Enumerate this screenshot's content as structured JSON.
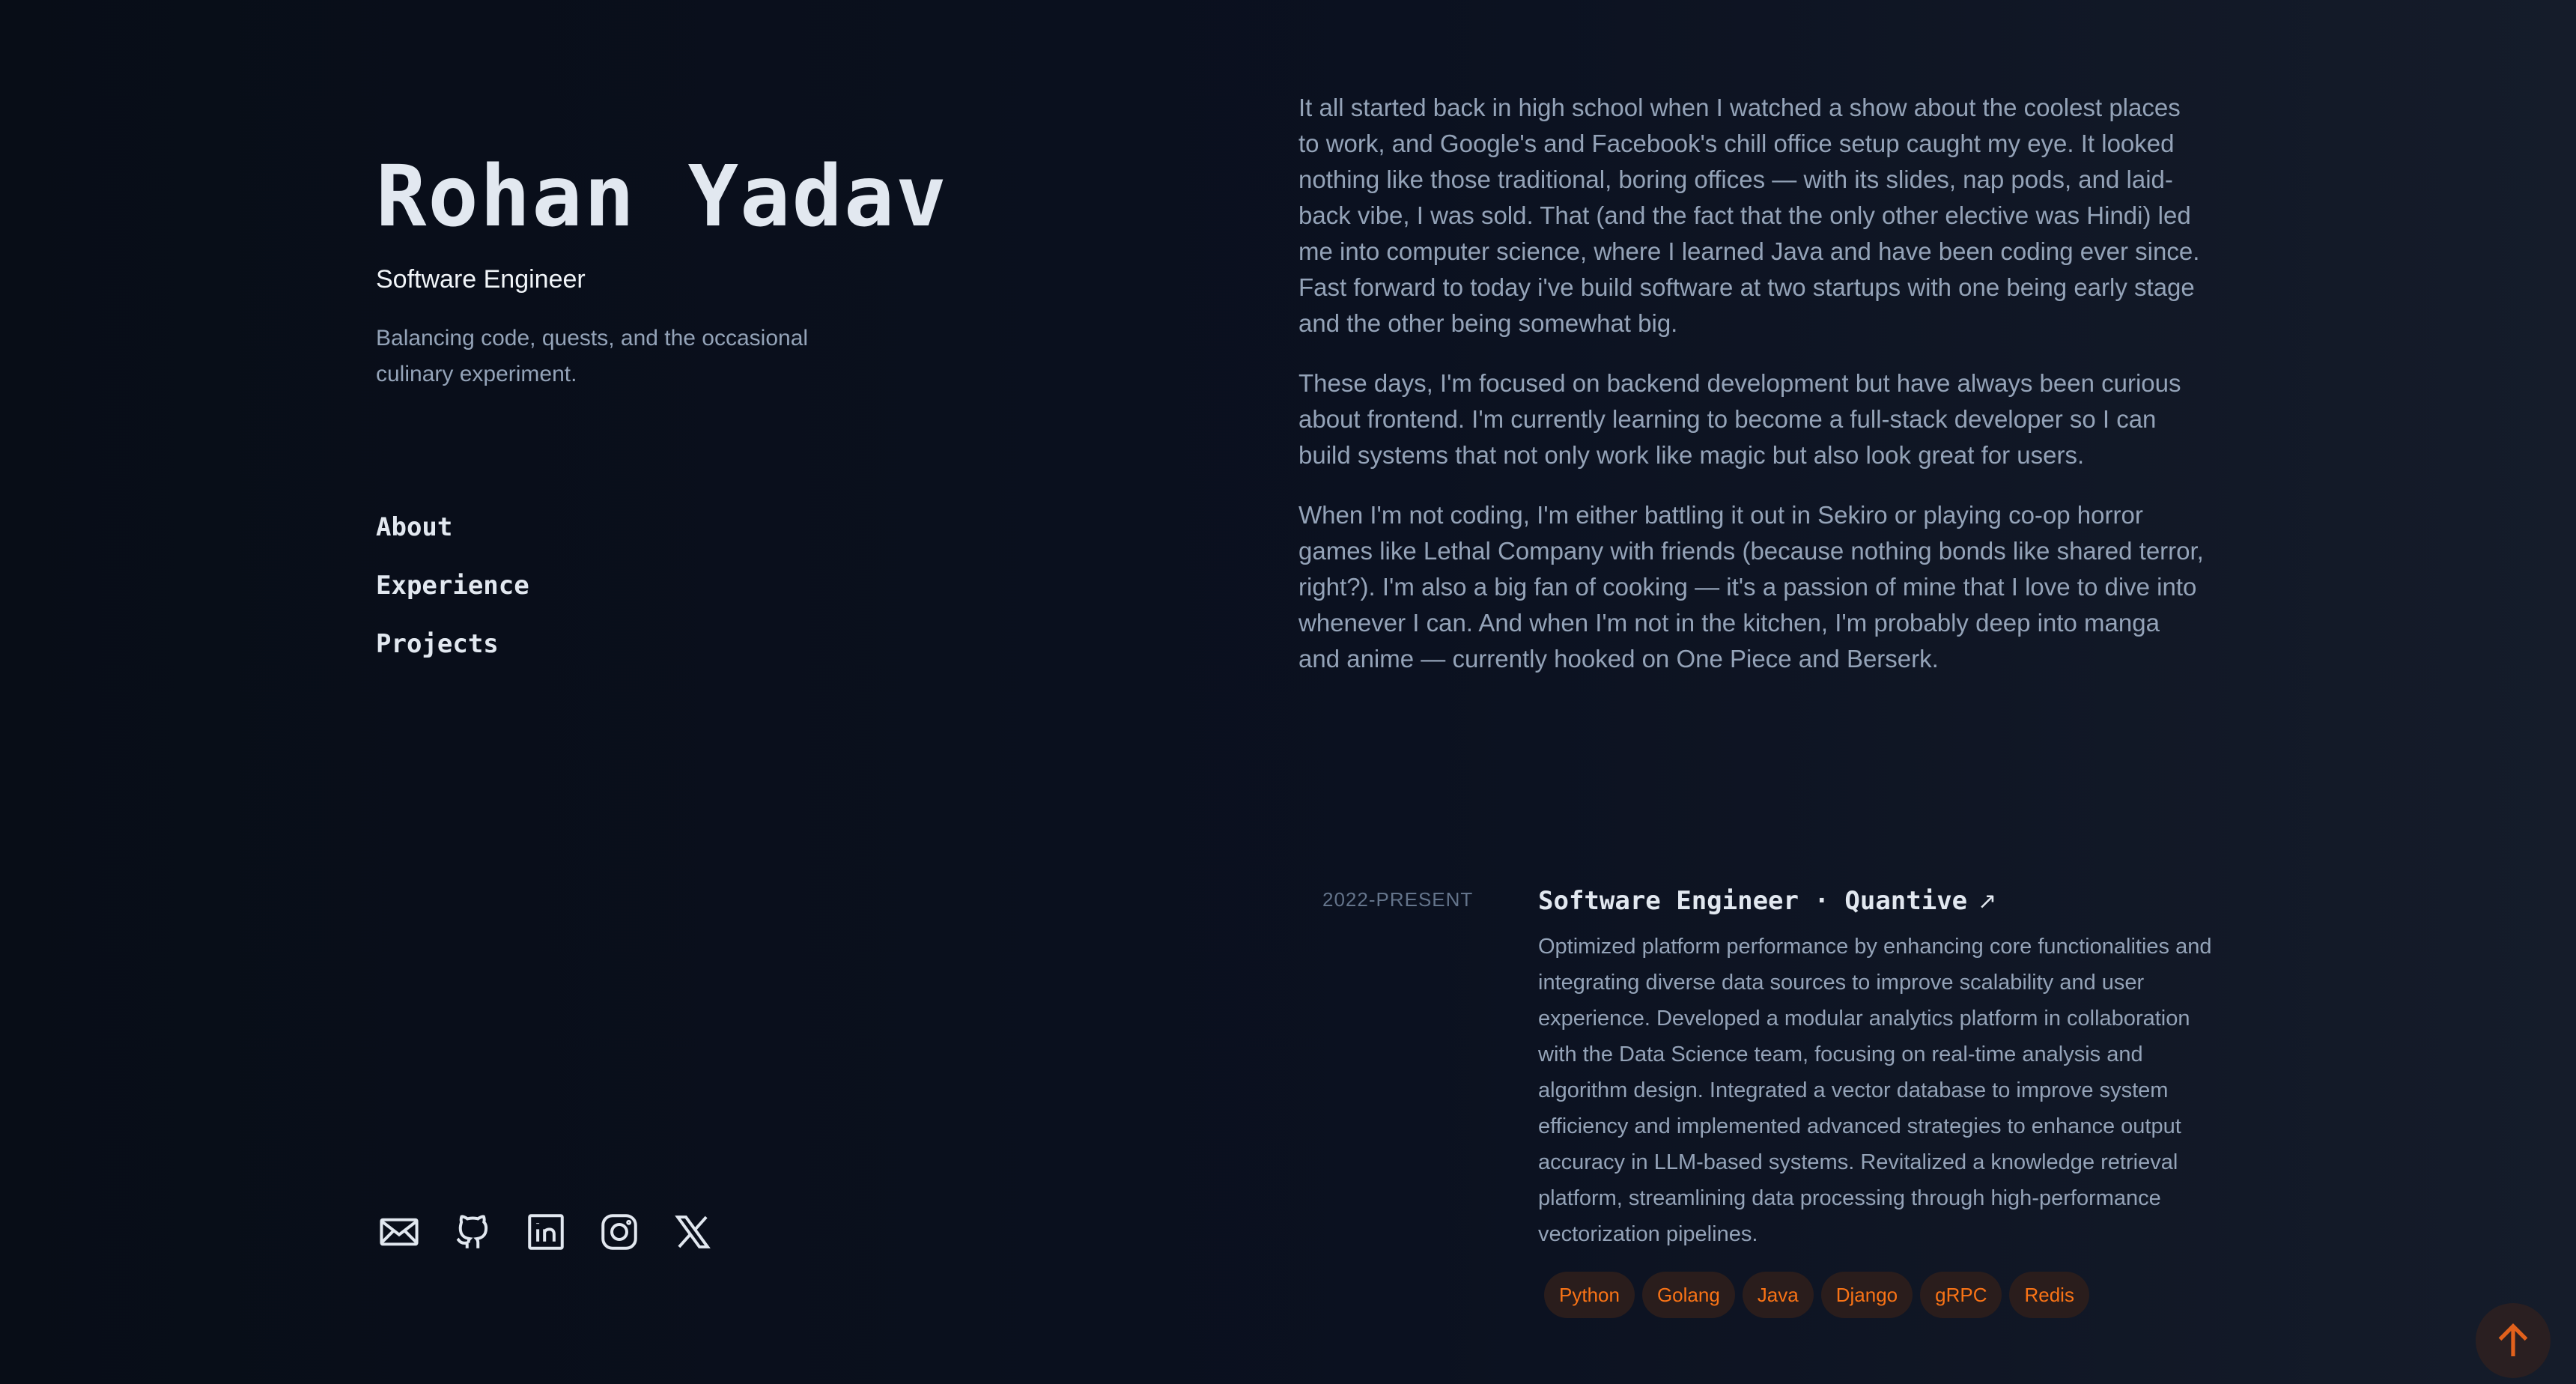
{
  "profile": {
    "name": "Rohan Yadav",
    "role": "Software Engineer",
    "tagline": "Balancing code, quests, and the occasional culinary experiment."
  },
  "nav": {
    "items": [
      "About",
      "Experience",
      "Projects"
    ]
  },
  "socials": {
    "icons": [
      "mail-icon",
      "github-icon",
      "linkedin-icon",
      "instagram-icon",
      "x-icon"
    ]
  },
  "about": {
    "paragraphs": [
      "It all started back in high school when I watched a show about the coolest places to work, and Google's and Facebook's chill office setup caught my eye. It looked nothing like those traditional, boring offices — with its slides, nap pods, and laid-back vibe, I was sold. That (and the fact that the only other elective was Hindi) led me into computer science, where I learned Java and have been coding ever since. Fast forward to today i've build software at two startups with one being early stage and the other being somewhat big.",
      "These days, I'm focused on backend development but have always been curious about frontend. I'm currently learning to become a full-stack developer so I can build systems that not only work like magic but also look great for users.",
      "When I'm not coding, I'm either battling it out in Sekiro or playing co-op horror games like Lethal Company with friends (because nothing bonds like shared terror, right?). I'm also a big fan of cooking — it's a passion of mine that I love to dive into whenever I can. And when I'm not in the kitchen, I'm probably deep into manga and anime — currently hooked on One Piece and Berserk."
    ]
  },
  "experience": {
    "date": "2022-PRESENT",
    "title": "Software Engineer · Quantive",
    "arrow": "↗",
    "description": "Optimized platform performance by enhancing core functionalities and integrating diverse data sources to improve scalability and user experience. Developed a modular analytics platform in collaboration with the Data Science team, focusing on real-time analysis and algorithm design. Integrated a vector database to improve system efficiency and implemented advanced strategies to enhance output accuracy in LLM-based systems. Revitalized a knowledge retrieval platform, streamlining data processing through high-performance vectorization pipelines.",
    "tags": [
      "Python",
      "Golang",
      "Java",
      "Django",
      "gRPC",
      "Redis"
    ]
  },
  "colors": {
    "accent": "#f97316",
    "text_primary": "#e2e8f0",
    "text_muted": "#94a3b8",
    "background": "#0b1120"
  }
}
